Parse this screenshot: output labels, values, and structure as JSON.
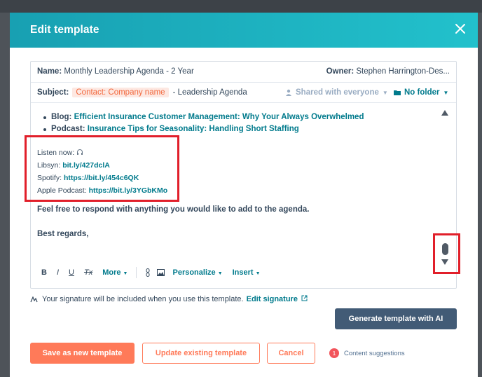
{
  "modal": {
    "title": "Edit template"
  },
  "template": {
    "name_label": "Name:",
    "name_value": "Monthly Leadership Agenda - 2 Year",
    "owner_label": "Owner:",
    "owner_value": "Stephen Harrington-Des...",
    "subject_label": "Subject:",
    "subject_token": "Contact: Company name",
    "subject_rest": "- Leadership Agenda",
    "shared_label": "Shared with everyone",
    "folder_label": "No folder"
  },
  "body": {
    "bullets": [
      {
        "label": "Blog:",
        "link": "Efficient Insurance Customer Management: Why Your Always Overwhelmed"
      },
      {
        "label": "Podcast:",
        "link": "Insurance Tips for Seasonality: Handling Short Staffing"
      }
    ],
    "listen_now": "Listen now:",
    "listen_links": [
      {
        "label": "Libsyn:",
        "url": "bit.ly/427dclA"
      },
      {
        "label": "Spotify:",
        "url": "https://bit.ly/454c6QK"
      },
      {
        "label": "Apple Podcast:",
        "url": "https://bit.ly/3YGbKMo"
      }
    ],
    "closing_line": "Feel free to respond with anything you would like to add to the agenda.",
    "sign_off": "Best regards,"
  },
  "toolbar": {
    "bold": "B",
    "italic": "I",
    "underline": "U",
    "clear_format": "Tx",
    "more": "More",
    "personalize": "Personalize",
    "insert": "Insert"
  },
  "signature": {
    "text": "Your signature will be included when you use this template.",
    "edit_link": "Edit signature"
  },
  "actions": {
    "generate_ai": "Generate template with AI",
    "save_new": "Save as new template",
    "update_existing": "Update existing template",
    "cancel": "Cancel",
    "suggestions_count": "1",
    "suggestions_label": "Content suggestions"
  },
  "colors": {
    "header_gradient_start": "#18a0b2",
    "header_gradient_end": "#22c1cc",
    "link": "#007a8c",
    "primary_button": "#ff7a59",
    "ai_button": "#425b76",
    "highlight": "#e11f2a"
  },
  "icons": [
    "close-icon",
    "headphones-icon",
    "user-icon",
    "folder-icon",
    "link-icon",
    "image-icon",
    "signature-icon",
    "external-link-icon",
    "chevron-up-icon",
    "chevron-down-icon"
  ]
}
